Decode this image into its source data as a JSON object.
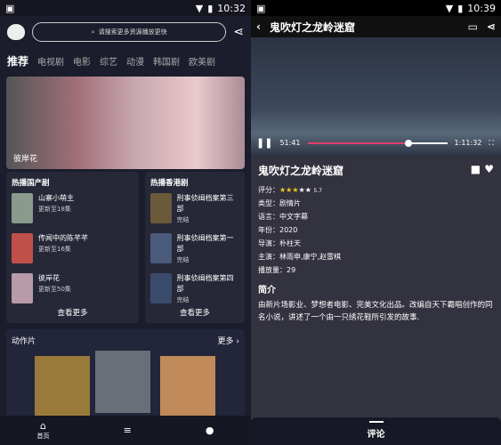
{
  "left": {
    "status": {
      "time": "10:32"
    },
    "search": {
      "placeholder": "请搜索更多资源播放更快"
    },
    "tabs": [
      "推荐",
      "电视剧",
      "电影",
      "综艺",
      "动漫",
      "韩国剧",
      "欧美剧"
    ],
    "banner": {
      "title": "彼岸花"
    },
    "cards": [
      {
        "title": "热播国产剧",
        "items": [
          {
            "name": "山寨小萌主",
            "sub": "更新至18集"
          },
          {
            "name": "传闻中的陈芊芊",
            "sub": "更新至16集"
          },
          {
            "name": "彼岸花",
            "sub": "更新至50集"
          }
        ],
        "more": "查看更多"
      },
      {
        "title": "热播香港剧",
        "items": [
          {
            "name": "刑事侦缉档案第三部",
            "sub": "完结"
          },
          {
            "name": "刑事侦缉档案第一部",
            "sub": "完结"
          },
          {
            "name": "刑事侦缉档案第四部",
            "sub": "完结"
          }
        ],
        "more": "查看更多"
      }
    ],
    "section": {
      "title": "动作片",
      "more": "更多"
    },
    "nav": {
      "home": "首页"
    }
  },
  "right": {
    "status": {
      "time": "10:39"
    },
    "title": "鬼吹灯之龙岭迷窟",
    "player": {
      "current": "51:41",
      "duration": "1:11:32",
      "progress": 0.72
    },
    "info": {
      "title": "鬼吹灯之龙岭迷窟",
      "rating_label": "评分：",
      "rating": 5.7,
      "stars_filled": 3,
      "stars_total": 5,
      "rows": [
        "类型：剧情片",
        "语言：中文字幕",
        "年份：2020",
        "导演：朴柱天",
        "主演：林雨申,康宁,赵雷棋",
        "播放量：29"
      ],
      "intro_title": "简介",
      "intro": " 由新片场影业、梦想者电影、完美文化出品。改编自天下霸唱创作的同名小说，讲述了一个由一只绣花鞋所引发的故事."
    },
    "tab": "评论"
  }
}
